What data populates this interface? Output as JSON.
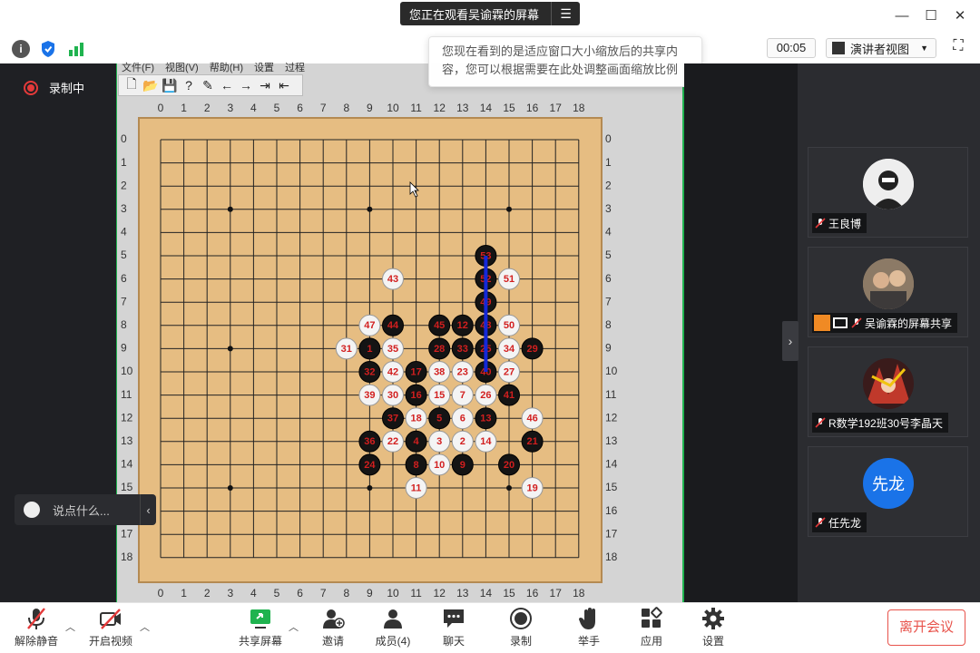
{
  "window": {
    "share_banner": "您正在观看吴谕霖的屏幕"
  },
  "toolbar": {
    "timer": "00:05",
    "view_mode": "演讲者视图"
  },
  "tooltip": {
    "line1": "您现在看到的是适应窗口大小缩放后的共享内",
    "line2": "容，您可以根据需要在此处调整画面缩放比例"
  },
  "recording": {
    "label": "录制中"
  },
  "app": {
    "menus": [
      "文件(F)",
      "视图(V)",
      "帮助(H)",
      "设置",
      "过程"
    ],
    "coords": [
      "0",
      "1",
      "2",
      "3",
      "4",
      "5",
      "6",
      "7",
      "8",
      "9",
      "10",
      "11",
      "12",
      "13",
      "14",
      "15",
      "16",
      "17",
      "18"
    ]
  },
  "chat_input": {
    "placeholder": "说点什么..."
  },
  "participants": [
    {
      "name": "王良博",
      "color": "#e8e8e8"
    },
    {
      "name": "吴谕霖的屏幕共享",
      "color": "#c9a37a"
    },
    {
      "name": "R数学192班30号李晶天",
      "color": "#c0392b"
    },
    {
      "name": "任先龙",
      "avatar_text": "先龙",
      "color": "#1a73e8"
    }
  ],
  "bottom_bar": {
    "mute": "解除静音",
    "video": "开启视频",
    "share": "共享屏幕",
    "invite": "邀请",
    "members": "成员(4)",
    "chat": "聊天",
    "record": "录制",
    "raise_hand": "举手",
    "apps": "应用",
    "settings": "设置",
    "leave": "离开会议"
  },
  "stones": [
    {
      "n": "1",
      "c": "b",
      "x": 9,
      "y": 9
    },
    {
      "n": "2",
      "c": "w",
      "x": 13,
      "y": 13
    },
    {
      "n": "3",
      "c": "w",
      "x": 12,
      "y": 13
    },
    {
      "n": "4",
      "c": "b",
      "x": 11,
      "y": 13
    },
    {
      "n": "5",
      "c": "b",
      "x": 12,
      "y": 12
    },
    {
      "n": "6",
      "c": "w",
      "x": 13,
      "y": 12
    },
    {
      "n": "7",
      "c": "w",
      "x": 13,
      "y": 11
    },
    {
      "n": "8",
      "c": "b",
      "x": 11,
      "y": 14
    },
    {
      "n": "9",
      "c": "b",
      "x": 13,
      "y": 14
    },
    {
      "n": "10",
      "c": "w",
      "x": 12,
      "y": 14
    },
    {
      "n": "11",
      "c": "w",
      "x": 11,
      "y": 15
    },
    {
      "n": "13",
      "c": "b",
      "x": 14,
      "y": 12
    },
    {
      "n": "14",
      "c": "w",
      "x": 14,
      "y": 13
    },
    {
      "n": "15",
      "c": "w",
      "x": 12,
      "y": 11
    },
    {
      "n": "16",
      "c": "b",
      "x": 11,
      "y": 11
    },
    {
      "n": "17",
      "c": "b",
      "x": 11,
      "y": 10
    },
    {
      "n": "18",
      "c": "w",
      "x": 11,
      "y": 12
    },
    {
      "n": "19",
      "c": "w",
      "x": 16,
      "y": 15
    },
    {
      "n": "20",
      "c": "b",
      "x": 15,
      "y": 14
    },
    {
      "n": "21",
      "c": "b",
      "x": 16,
      "y": 13
    },
    {
      "n": "22",
      "c": "w",
      "x": 10,
      "y": 13
    },
    {
      "n": "23",
      "c": "w",
      "x": 13,
      "y": 10
    },
    {
      "n": "24",
      "c": "b",
      "x": 9,
      "y": 14
    },
    {
      "n": "25",
      "c": "b",
      "x": 14,
      "y": 9
    },
    {
      "n": "26",
      "c": "w",
      "x": 14,
      "y": 11
    },
    {
      "n": "27",
      "c": "w",
      "x": 15,
      "y": 10
    },
    {
      "n": "28",
      "c": "b",
      "x": 12,
      "y": 9
    },
    {
      "n": "29",
      "c": "b",
      "x": 16,
      "y": 9
    },
    {
      "n": "30",
      "c": "w",
      "x": 10,
      "y": 11
    },
    {
      "n": "31",
      "c": "w",
      "x": 8,
      "y": 9
    },
    {
      "n": "32",
      "c": "b",
      "x": 9,
      "y": 10
    },
    {
      "n": "33",
      "c": "b",
      "x": 13,
      "y": 9
    },
    {
      "n": "34",
      "c": "w",
      "x": 15,
      "y": 9
    },
    {
      "n": "35",
      "c": "w",
      "x": 10,
      "y": 9
    },
    {
      "n": "36",
      "c": "b",
      "x": 9,
      "y": 13
    },
    {
      "n": "37",
      "c": "b",
      "x": 10,
      "y": 12
    },
    {
      "n": "38",
      "c": "w",
      "x": 12,
      "y": 10
    },
    {
      "n": "39",
      "c": "w",
      "x": 9,
      "y": 11
    },
    {
      "n": "40",
      "c": "b",
      "x": 14,
      "y": 10
    },
    {
      "n": "41",
      "c": "b",
      "x": 15,
      "y": 11
    },
    {
      "n": "42",
      "c": "w",
      "x": 10,
      "y": 10
    },
    {
      "n": "43",
      "c": "w",
      "x": 10,
      "y": 6
    },
    {
      "n": "44",
      "c": "b",
      "x": 10,
      "y": 8
    },
    {
      "n": "45",
      "c": "b",
      "x": 12,
      "y": 8
    },
    {
      "n": "46",
      "c": "w",
      "x": 16,
      "y": 12
    },
    {
      "n": "47",
      "c": "w",
      "x": 9,
      "y": 8
    },
    {
      "n": "48",
      "c": "b",
      "x": 14,
      "y": 8
    },
    {
      "n": "49",
      "c": "b",
      "x": 14,
      "y": 7
    },
    {
      "n": "50",
      "c": "w",
      "x": 15,
      "y": 8
    },
    {
      "n": "51",
      "c": "w",
      "x": 15,
      "y": 6
    },
    {
      "n": "52",
      "c": "b",
      "x": 14,
      "y": 6
    },
    {
      "n": "53",
      "c": "b",
      "x": 14,
      "y": 5
    },
    {
      "n": "12",
      "c": "b",
      "x": 13,
      "y": 8
    }
  ]
}
